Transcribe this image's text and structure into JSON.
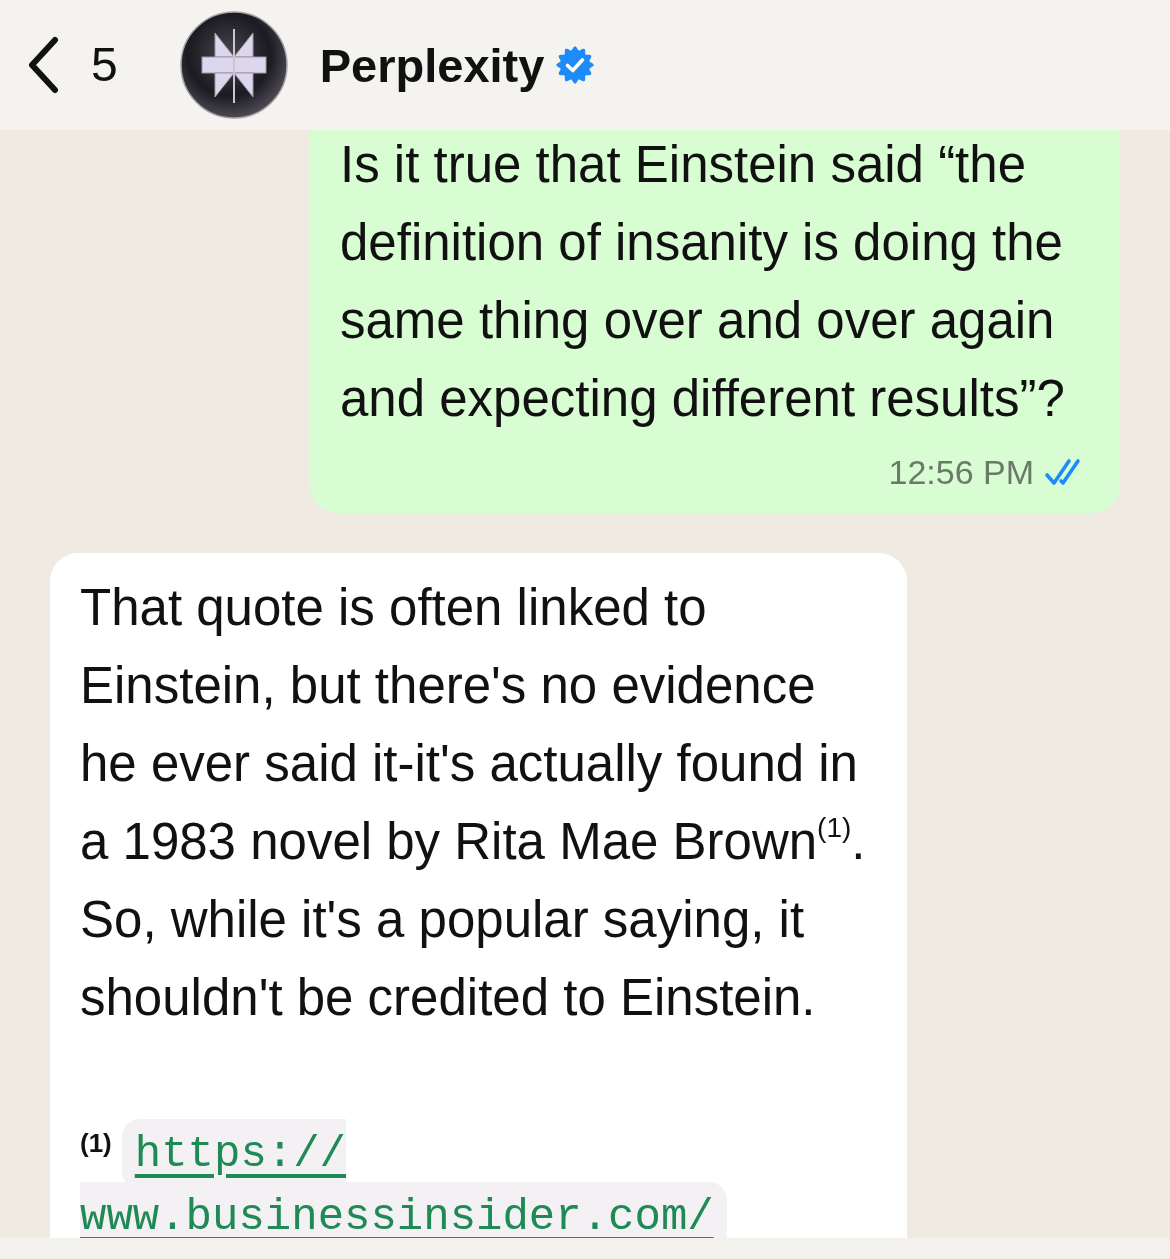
{
  "header": {
    "back_count": "5",
    "contact_name": "Perplexity",
    "verified": true
  },
  "messages": [
    {
      "kind": "outgoing",
      "text": "Is it true that Einstein said “the definition of insanity is doing the same thing over and over again and expecting different results”?",
      "time": "12:56 PM",
      "read": true
    },
    {
      "kind": "incoming",
      "text": "That quote is often linked to Einstein, but there's no evidence he ever said it-it's actually found in a 1983 novel by Rita Mae Brown$^{(1)}$. So, while it's a popular saying, it shouldn't be credited to Einstein.",
      "footnotes": [
        {
          "marker": "(1)",
          "url": "https://www.businessinsider.com/"
        }
      ]
    }
  ]
}
